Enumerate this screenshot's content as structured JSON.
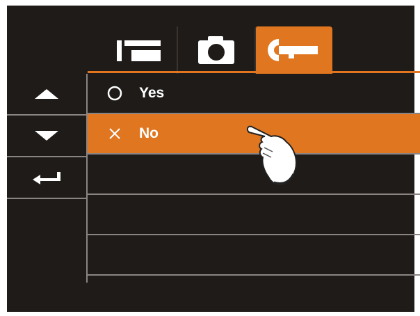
{
  "tabs": [
    {
      "id": "playback",
      "icon": "playback-icon",
      "active": false
    },
    {
      "id": "camera",
      "icon": "camera-icon",
      "active": false
    },
    {
      "id": "settings",
      "icon": "wrench-icon",
      "active": true
    }
  ],
  "sidebar": {
    "buttons": [
      {
        "icon": "arrow-up-icon"
      },
      {
        "icon": "arrow-down-icon"
      },
      {
        "icon": "return-icon"
      }
    ]
  },
  "options": [
    {
      "label": "Yes",
      "marker": "circle-icon",
      "selected": false
    },
    {
      "label": "No",
      "marker": "cross-icon",
      "selected": true
    }
  ],
  "colors": {
    "accent": "#e0761f",
    "background": "#1f1b19",
    "divider": "#8a8583",
    "text": "#ffffff"
  }
}
